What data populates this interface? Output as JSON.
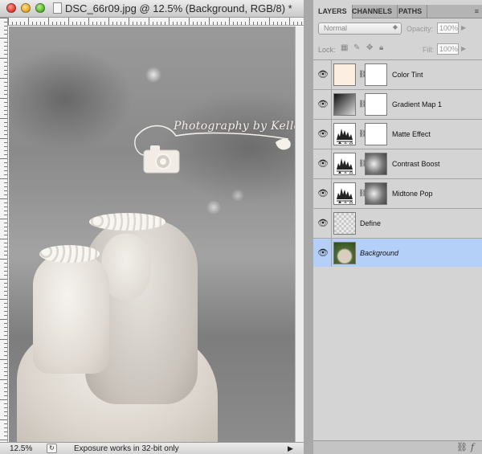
{
  "document": {
    "title": "DSC_66r09.jpg @ 12.5% (Background, RGB/8) *",
    "watermark": "Photography by Kelley",
    "status": {
      "zoom": "12.5%",
      "message": "Exposure works in 32-bit only",
      "arrow": "▶"
    }
  },
  "panel": {
    "tabs": [
      "LAYERS",
      "CHANNELS",
      "PATHS"
    ],
    "menu_icon": "menu-icon",
    "blend_mode": "Normal",
    "opacity_label": "Opacity:",
    "opacity_value": "100%",
    "lock_label": "Lock:",
    "fill_label": "Fill:",
    "fill_value": "100%",
    "layers": [
      {
        "name": "Color Tint",
        "thumb": "tint",
        "mask": "white",
        "selected": false,
        "italic": false
      },
      {
        "name": "Gradient Map 1",
        "thumb": "gradient",
        "mask": "white",
        "selected": false,
        "italic": false
      },
      {
        "name": "Matte Effect",
        "thumb": "adjustment-levels",
        "mask": "white",
        "selected": false,
        "italic": false
      },
      {
        "name": "Contrast Boost",
        "thumb": "adjustment-levels",
        "mask": "photo",
        "selected": false,
        "italic": false
      },
      {
        "name": "Midtone Pop",
        "thumb": "adjustment-levels",
        "mask": "photo",
        "selected": false,
        "italic": false
      },
      {
        "name": "Define",
        "thumb": "transparent",
        "mask": "",
        "selected": false,
        "italic": false
      },
      {
        "name": "Background",
        "thumb": "photo",
        "mask": "",
        "selected": true,
        "italic": true
      }
    ]
  },
  "colors": {
    "selected_row": "#b4d0f8",
    "panel_bg": "#d4d4d4"
  }
}
